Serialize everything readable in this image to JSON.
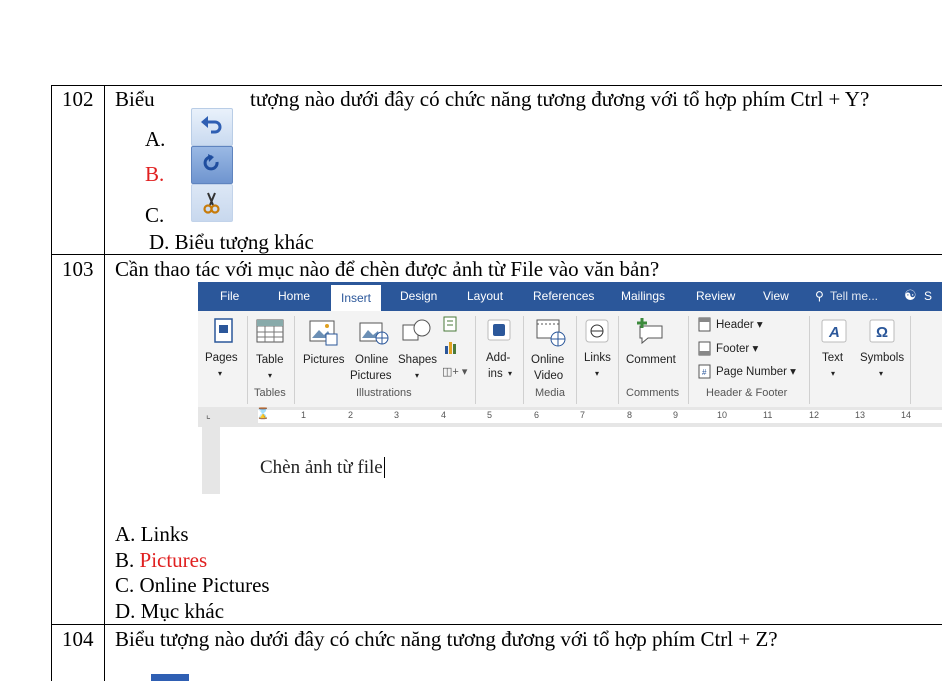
{
  "questions": [
    {
      "number": "102",
      "stem_part1": "Biểu",
      "stem_part2": "tượng nào dưới đây có chức năng tương đương với tổ hợp phím Ctrl + Y?",
      "options": [
        {
          "label": "A.",
          "icon": "undo-icon"
        },
        {
          "label": "B.",
          "icon": "redo-icon",
          "correct": true
        },
        {
          "label": "C.",
          "icon": "cut-scissors-icon"
        },
        {
          "label": "D. Biểu tượng khác"
        }
      ]
    },
    {
      "number": "103",
      "stem": "Cần thao tác với mục nào để chèn được ảnh từ File vào văn bản?",
      "options": [
        {
          "label": "A.",
          "text": "Links"
        },
        {
          "label": "B.",
          "text": "Pictures",
          "correct": true
        },
        {
          "label": "C.",
          "text": "Online Pictures"
        },
        {
          "label": "D.",
          "text": "Mục khác"
        }
      ]
    },
    {
      "number": "104",
      "stem": "Biểu tượng nào dưới đây có chức năng tương đương với tổ hợp phím Ctrl + Z?"
    }
  ],
  "word_screenshot": {
    "tabs": [
      "File",
      "Home",
      "Insert",
      "Design",
      "Layout",
      "References",
      "Mailings",
      "Review",
      "View",
      "Tell me...",
      "S"
    ],
    "active_tab": "Insert",
    "buttons": {
      "pages": "Pages",
      "table": "Table",
      "pictures": "Pictures",
      "online_pictures_1": "Online",
      "online_pictures_2": "Pictures",
      "shapes": "Shapes",
      "addins_1": "Add-",
      "addins_2": "ins",
      "online_video_1": "Online",
      "online_video_2": "Video",
      "links": "Links",
      "comment": "Comment",
      "header": "Header",
      "footer": "Footer",
      "page_number": "Page Number",
      "text": "Text",
      "symbols": "Symbols"
    },
    "groups": [
      "Tables",
      "Illustrations",
      "Media",
      "Comments",
      "Header & Footer"
    ],
    "ruler_numbers": [
      "1",
      "2",
      "3",
      "4",
      "5",
      "6",
      "7",
      "8",
      "9",
      "10",
      "11",
      "12",
      "13",
      "14"
    ],
    "doc_text": "Chèn ảnh từ file",
    "colors": {
      "ribbon_blue": "#2b579a",
      "ribbon_bg": "#f3f3f3"
    }
  },
  "colors": {
    "correct": "#e02020"
  }
}
